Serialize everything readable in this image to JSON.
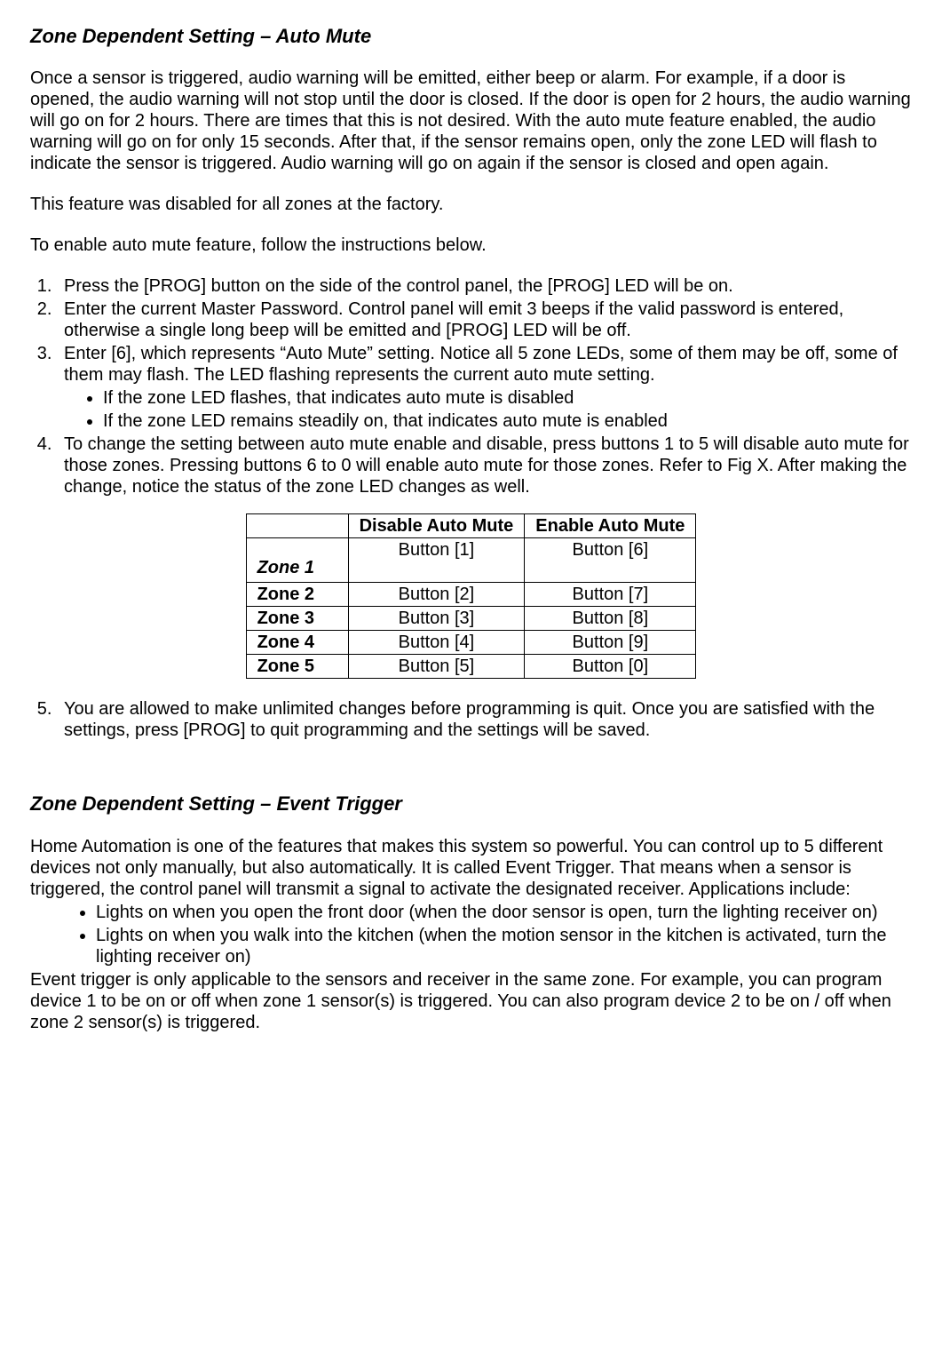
{
  "section1": {
    "heading": "Zone Dependent Setting – Auto Mute",
    "p1": "Once a sensor is triggered, audio warning will be emitted, either beep or alarm.  For example, if a door is opened, the audio warning will not stop until the door is closed.  If the door is open for 2 hours, the audio warning will go on for 2 hours.  There are times that this is not desired.  With the auto mute feature enabled, the audio warning will go on for only 15 seconds.  After that, if the sensor remains open, only the zone LED will flash to indicate the sensor is triggered.  Audio warning will go on again if the sensor is closed and open again.",
    "p2": "This feature was disabled for all zones at the factory.",
    "p3": "To enable auto mute feature, follow the instructions below.",
    "steps": {
      "s1": "Press the [PROG] button on the side of the control panel, the [PROG] LED will be on.",
      "s2": "Enter the current Master Password.  Control panel will emit 3 beeps if the valid password is entered, otherwise a single long beep will be emitted and [PROG] LED will be off.",
      "s3": "Enter [6], which represents “Auto Mute” setting.  Notice all 5 zone LEDs, some of them may be off, some of them may flash.  The LED flashing represents the current auto mute setting.",
      "s3b1": "If the zone LED flashes, that indicates auto mute is disabled",
      "s3b2": "If the zone LED remains steadily on, that indicates auto mute is enabled",
      "s4": "To change the setting between auto mute enable and disable, press buttons 1 to 5 will disable auto mute for those zones.  Pressing buttons 6 to 0 will enable auto mute for those zones.  Refer to Fig X.  After making the change, notice the status of the zone LED changes as well.",
      "s5": "You are allowed to make unlimited changes before programming is quit.  Once you are satisfied with the settings, press [PROG] to quit programming and the settings will be saved."
    },
    "table": {
      "h_disable": "Disable Auto Mute",
      "h_enable": "Enable Auto Mute",
      "rows": [
        {
          "zone": "Zone 1",
          "disable": "Button [1]",
          "enable": "Button [6]"
        },
        {
          "zone": "Zone 2",
          "disable": "Button [2]",
          "enable": "Button [7]"
        },
        {
          "zone": "Zone 3",
          "disable": "Button [3]",
          "enable": "Button [8]"
        },
        {
          "zone": "Zone 4",
          "disable": "Button [4]",
          "enable": "Button [9]"
        },
        {
          "zone": "Zone 5",
          "disable": "Button [5]",
          "enable": "Button [0]"
        }
      ]
    }
  },
  "section2": {
    "heading": "Zone Dependent Setting – Event Trigger",
    "p1": "Home Automation is one of the features that makes this system so powerful.  You can control up to 5 different devices not only manually, but also automatically.  It is called Event Trigger.  That means when a sensor is triggered, the control panel will transmit a signal to activate the designated receiver.  Applications include:",
    "b1": "Lights on when you open the front door (when the door sensor is open, turn the lighting receiver on)",
    "b2": "Lights on when you walk into the kitchen (when the motion sensor in the kitchen is activated, turn the lighting receiver on)",
    "p2": "Event trigger is only applicable to the sensors and receiver in the same zone.  For example, you can program device 1 to be on or off when zone 1 sensor(s) is triggered.  You can also program device 2 to be on / off when zone 2 sensor(s) is triggered."
  }
}
